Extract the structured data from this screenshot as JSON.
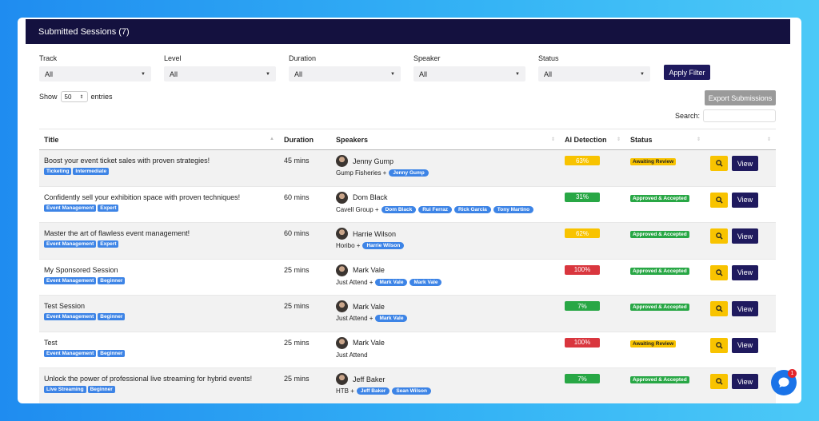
{
  "header": {
    "title": "Submitted Sessions (7)"
  },
  "filters": [
    {
      "label": "Track",
      "value": "All"
    },
    {
      "label": "Level",
      "value": "All"
    },
    {
      "label": "Duration",
      "value": "All"
    },
    {
      "label": "Speaker",
      "value": "All"
    },
    {
      "label": "Status",
      "value": "All"
    }
  ],
  "apply_label": "Apply Filter",
  "export_label": "Export Submissions",
  "show": {
    "prefix": "Show",
    "value": "50",
    "suffix": "entries"
  },
  "search": {
    "label": "Search:",
    "value": ""
  },
  "columns": {
    "title": "Title",
    "duration": "Duration",
    "speakers": "Speakers",
    "ai": "AI Detection",
    "status": "Status"
  },
  "colors": {
    "ai_high": "#d9363e",
    "ai_mid": "#f8c300",
    "ai_low": "#28a745",
    "status_review": "#f8c300",
    "status_accepted": "#28a745",
    "accent": "#1f1a5e"
  },
  "rows": [
    {
      "title": "Boost your event ticket sales with proven strategies!",
      "tags": [
        "Ticketing",
        "Intermediate"
      ],
      "duration": "45 mins",
      "speaker": "Jenny Gump",
      "company": "Gump Fisheries +",
      "pills": [
        "Jenny Gump"
      ],
      "ai": "63%",
      "ai_level": "mid",
      "status": "Awaiting Review",
      "status_type": "review",
      "view": "View"
    },
    {
      "title": "Confidently sell your exhibition space with proven techniques!",
      "tags": [
        "Event Management",
        "Expert"
      ],
      "duration": "60 mins",
      "speaker": "Dom Black",
      "company": "Cavell Group +",
      "pills": [
        "Dom Black",
        "Rui Ferraz",
        "Rick Garcia",
        "Tony Martino"
      ],
      "ai": "31%",
      "ai_level": "low",
      "status": "Approved & Accepted",
      "status_type": "accepted",
      "view": "View"
    },
    {
      "title": "Master the art of flawless event management!",
      "tags": [
        "Event Management",
        "Expert"
      ],
      "duration": "60 mins",
      "speaker": "Harrie Wilson",
      "company": "Horibo +",
      "pills": [
        "Harrie Wilson"
      ],
      "ai": "62%",
      "ai_level": "mid",
      "status": "Approved & Accepted",
      "status_type": "accepted",
      "view": "View"
    },
    {
      "title": "My Sponsored Session",
      "tags": [
        "Event Management",
        "Beginner"
      ],
      "duration": "25 mins",
      "speaker": "Mark Vale",
      "company": "Just Attend +",
      "pills": [
        "Mark Vale",
        "Mark Vale"
      ],
      "ai": "100%",
      "ai_level": "high",
      "status": "Approved & Accepted",
      "status_type": "accepted",
      "view": "View"
    },
    {
      "title": "Test Session",
      "tags": [
        "Event Management",
        "Beginner"
      ],
      "duration": "25 mins",
      "speaker": "Mark Vale",
      "company": "Just Attend +",
      "pills": [
        "Mark Vale"
      ],
      "ai": "7%",
      "ai_level": "low",
      "status": "Approved & Accepted",
      "status_type": "accepted",
      "view": "View"
    },
    {
      "title": "Test",
      "tags": [
        "Event Management",
        "Beginner"
      ],
      "duration": "25 mins",
      "speaker": "Mark Vale",
      "company": "Just Attend",
      "pills": [],
      "ai": "100%",
      "ai_level": "high",
      "status": "Awaiting Review",
      "status_type": "review",
      "view": "View"
    },
    {
      "title": "Unlock the power of professional live streaming for hybrid events!",
      "tags": [
        "Live Streaming",
        "Beginner"
      ],
      "duration": "25 mins",
      "speaker": "Jeff Baker",
      "company": "HTB +",
      "pills": [
        "Jeff Baker",
        "Sean Wilson"
      ],
      "ai": "7%",
      "ai_level": "low",
      "status": "Approved & Accepted",
      "status_type": "accepted",
      "view": "View"
    }
  ],
  "chat": {
    "badge": "1"
  }
}
